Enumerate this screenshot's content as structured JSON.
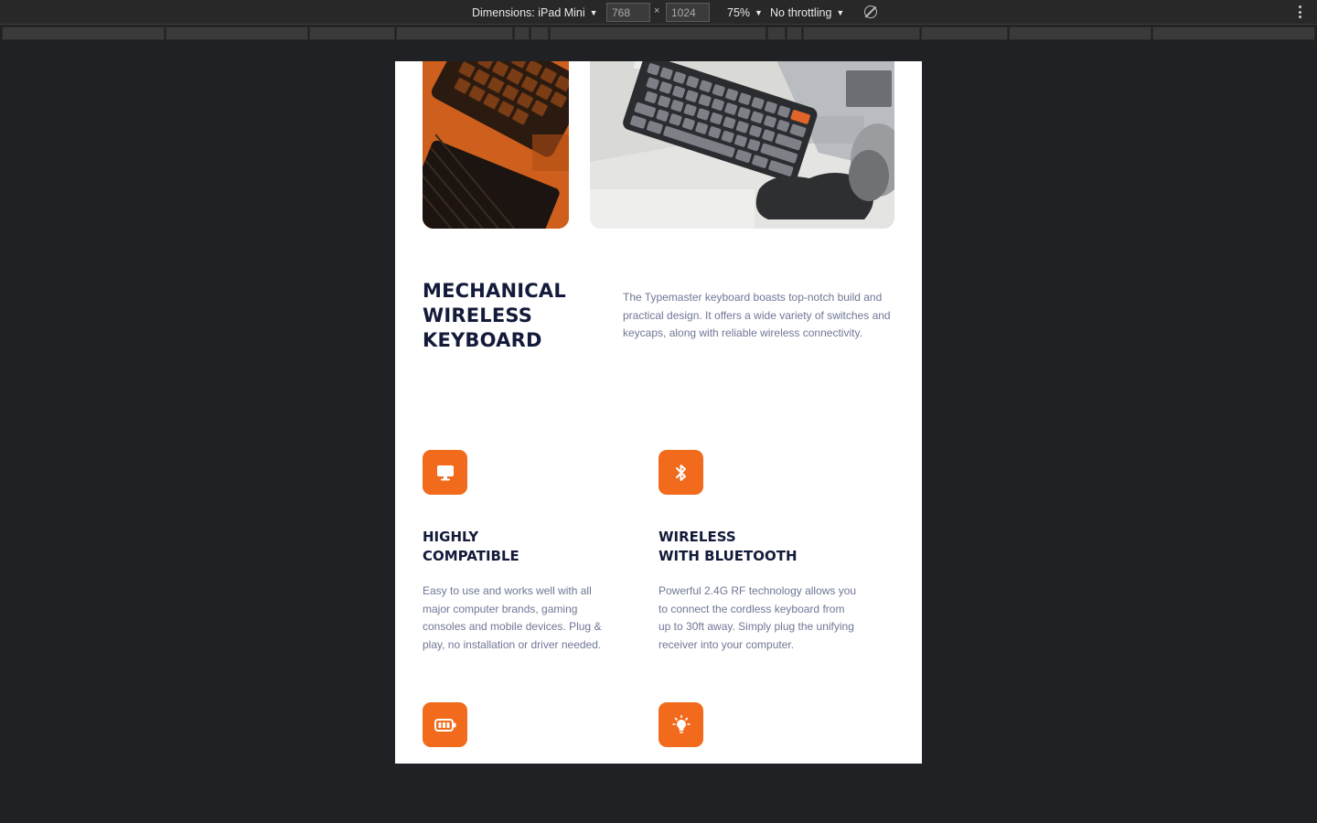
{
  "devtools": {
    "dimensions_label": "Dimensions: iPad Mini",
    "width_value": "768",
    "height_value": "1024",
    "times_symbol": "×",
    "zoom": "75%",
    "throttling": "No throttling"
  },
  "hero": {
    "headline_lines": [
      "MECHANICAL",
      "WIRELESS",
      "KEYBOARD"
    ],
    "lead": "The Typemaster keyboard boasts top-notch build and practical design. It offers a wide variety of switches and keycaps, along with reliable wireless connectivity."
  },
  "features": [
    {
      "icon": "monitor-icon",
      "title_lines": [
        "HIGHLY",
        "COMPATIBLE"
      ],
      "text": "Easy to use and works well with all major computer brands, gaming consoles and mobile devices. Plug & play, no installation or driver needed."
    },
    {
      "icon": "bluetooth-icon",
      "title_lines": [
        "WIRELESS",
        "WITH BLUETOOTH"
      ],
      "text": "Powerful 2.4G RF technology allows you to connect the cordless keyboard from up to 30ft away. Simply plug the unifying receiver into your computer."
    },
    {
      "icon": "battery-icon"
    },
    {
      "icon": "lightbulb-icon"
    }
  ],
  "colors": {
    "accent": "#f26a1b",
    "heading": "#131a3a",
    "body_text": "#6f7796",
    "devtools_bg": "#282828",
    "canvas_bg": "#202124"
  }
}
